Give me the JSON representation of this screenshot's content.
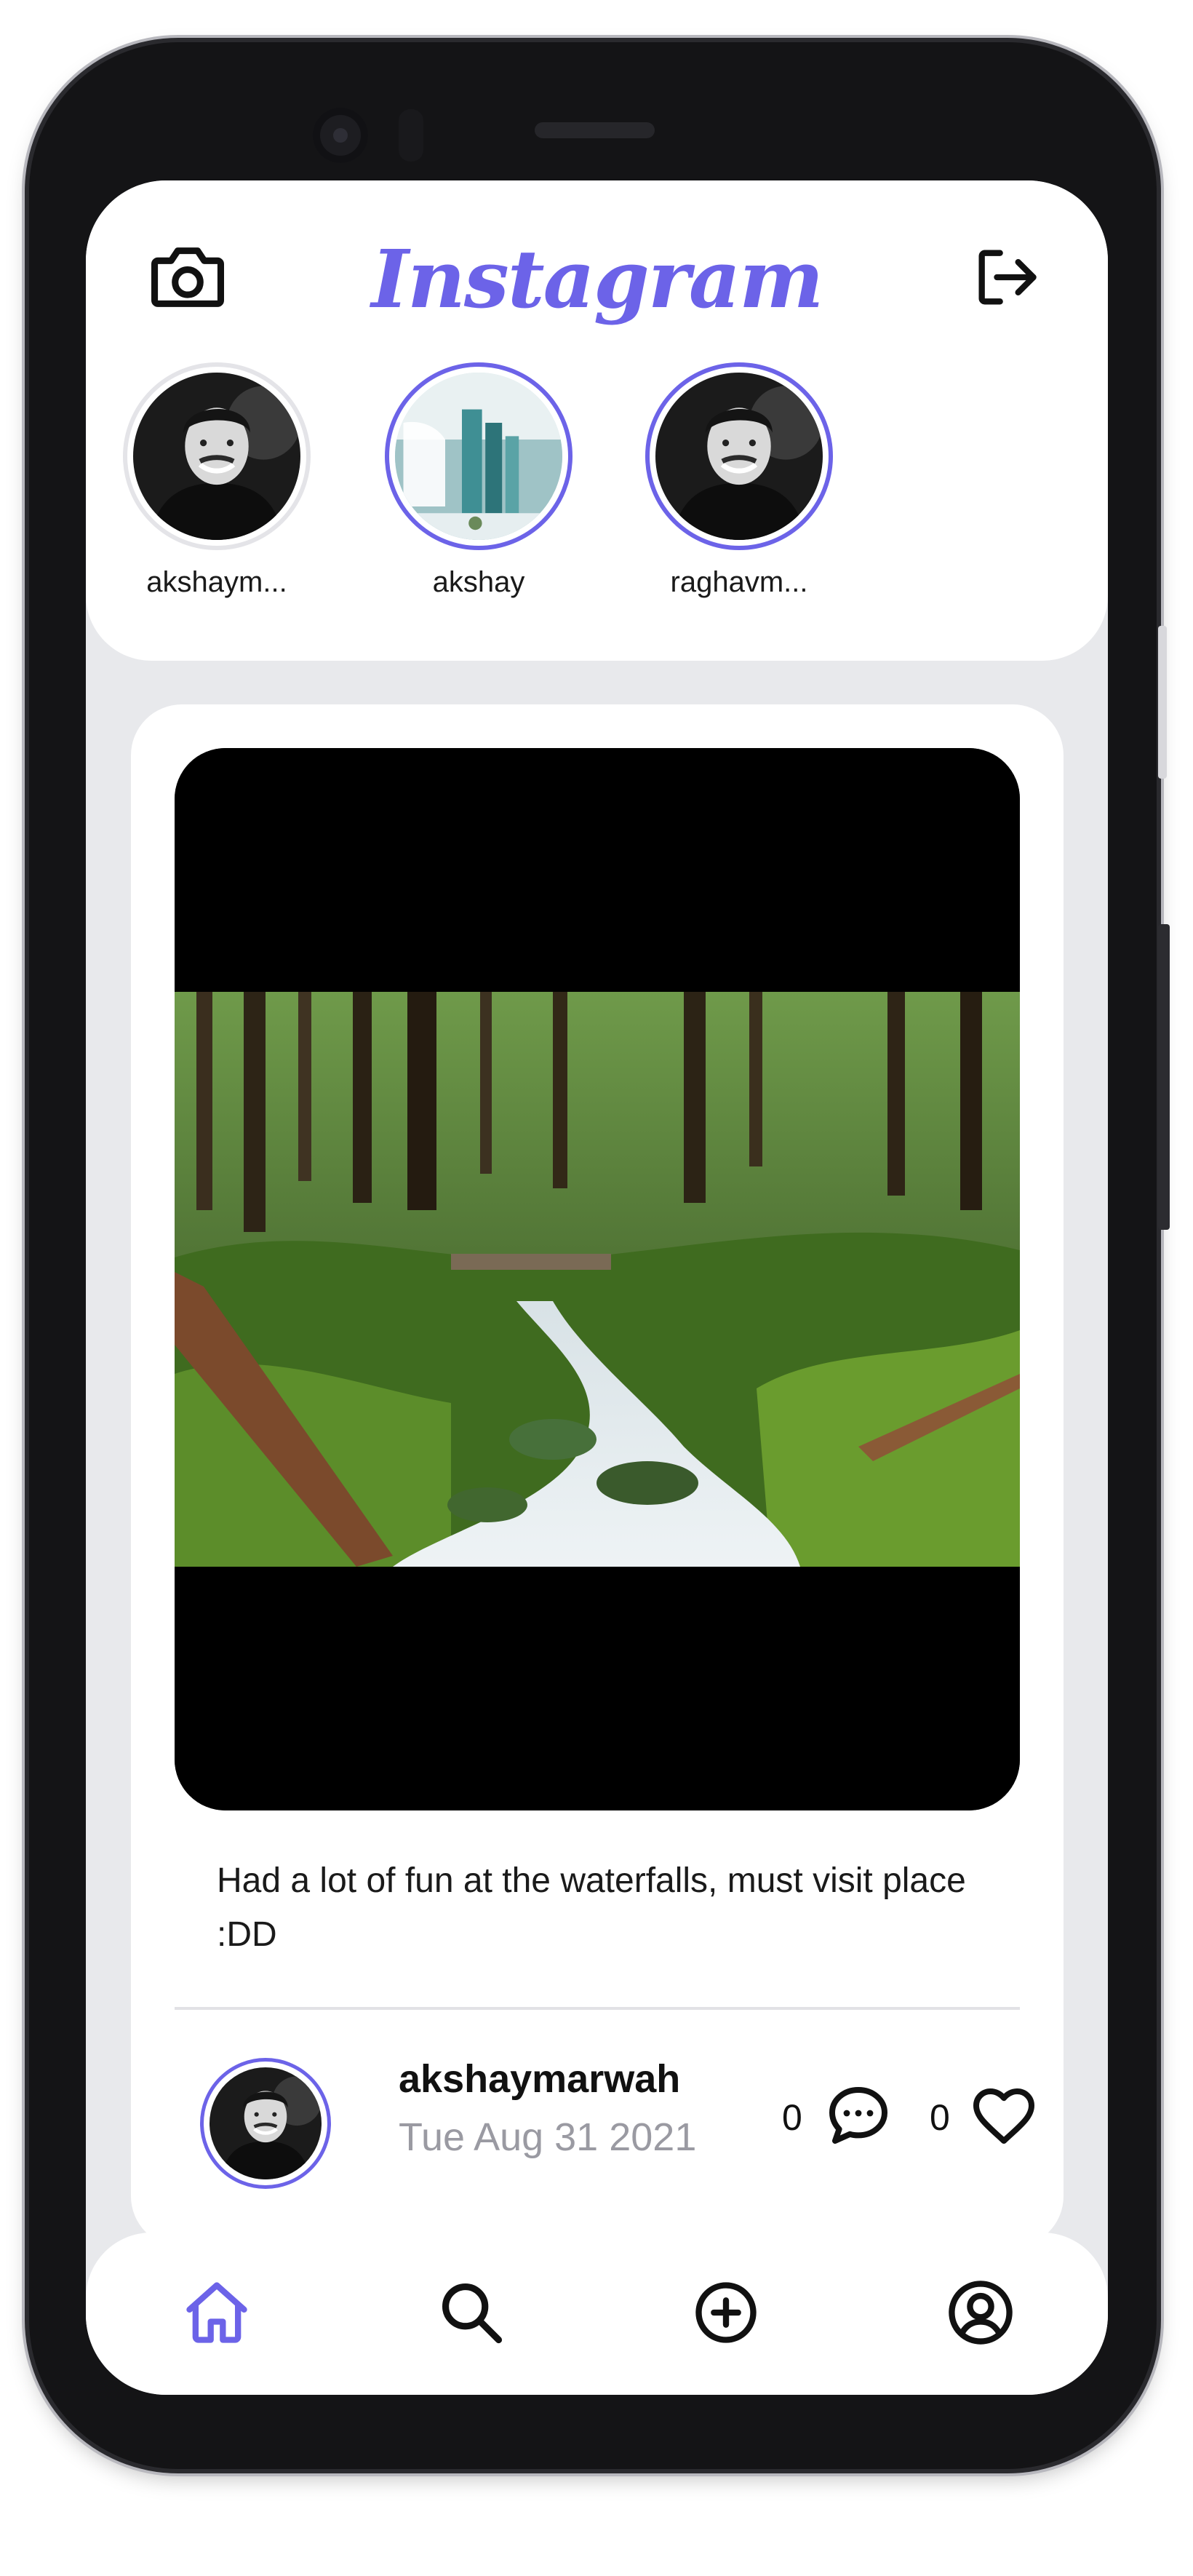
{
  "app": {
    "title": "Instagram",
    "accent_color": "#6c63e8",
    "header": {
      "left_icon": "camera-icon",
      "right_icon": "logout-icon"
    }
  },
  "stories": [
    {
      "username": "akshaym...",
      "avatar": "user-photo-avatar",
      "viewed": true
    },
    {
      "username": "akshay",
      "avatar": "waterfall-city-avatar",
      "viewed": false
    },
    {
      "username": "raghavm...",
      "avatar": "user-photo-avatar",
      "viewed": false
    }
  ],
  "post": {
    "image": "forest-stream-photo",
    "caption": "Had a lot of fun at the waterfalls, must visit place :DD",
    "author": "akshaymarwah",
    "date": "Tue Aug 31 2021",
    "comments_count": "0",
    "likes_count": "0"
  },
  "bottom_nav": [
    {
      "name": "home",
      "icon": "home-icon",
      "active": true
    },
    {
      "name": "search",
      "icon": "search-icon",
      "active": false
    },
    {
      "name": "add-post",
      "icon": "plus-circle-icon",
      "active": false
    },
    {
      "name": "profile",
      "icon": "user-circle-icon",
      "active": false
    }
  ]
}
